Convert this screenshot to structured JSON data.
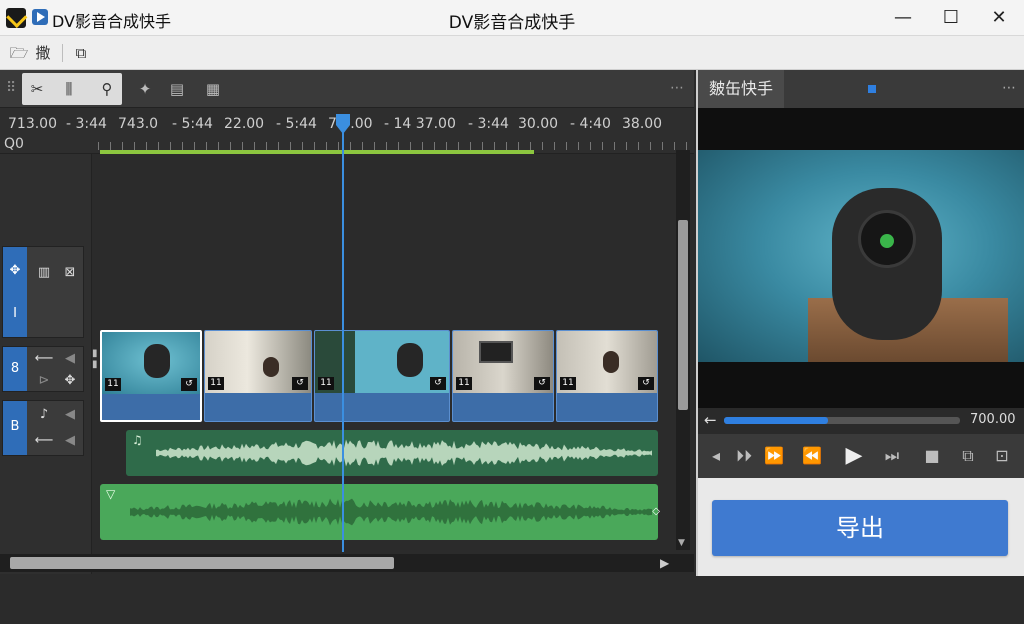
{
  "window": {
    "app_name": "DV影音合成快手",
    "title": "DV影音合成快手",
    "minimize": "—",
    "maximize": "☐",
    "close": "✕"
  },
  "toolbar": {
    "item1": "🗁 ",
    "item1_label": "撒",
    "item2": "⧉"
  },
  "editor_tools": {
    "grip": "⠿",
    "more": "⋯"
  },
  "ruler": {
    "labels": [
      "713.00",
      "- 3:44",
      "743.0",
      "- 5:44",
      "22.00",
      "- 5:44",
      "7.5.00",
      "- 14 37.00",
      "- 3:44",
      "30.00",
      "- 4:40",
      "38.00"
    ],
    "sub_label": "Q0"
  },
  "tracks": {
    "video_track_number": "I",
    "audio1_number": "8",
    "audio2_number": "B"
  },
  "clips": [
    {
      "badge_l": "11",
      "badge_r": "↺"
    },
    {
      "badge_l": "11",
      "badge_r": "↺"
    },
    {
      "badge_l": "11",
      "badge_r": "↺"
    },
    {
      "badge_l": "11",
      "badge_r": "↺"
    },
    {
      "badge_l": "11",
      "badge_r": "↺"
    }
  ],
  "audio": {
    "track1_mark": "♫",
    "track2_mark": "▽",
    "track2_end": "◇"
  },
  "preview": {
    "tab_label": "麬缶快手",
    "more": "⋯",
    "back_arrow": "←",
    "time": "700.00",
    "progress_fraction": 0.44
  },
  "controls": {
    "prev_frame": "◂",
    "step_fwd": "⏵⏵",
    "fast_fwd": "⏩",
    "rewind": "⏪",
    "play": "▶",
    "next": "⏭",
    "stop": "■"
  },
  "export_label": "导出"
}
